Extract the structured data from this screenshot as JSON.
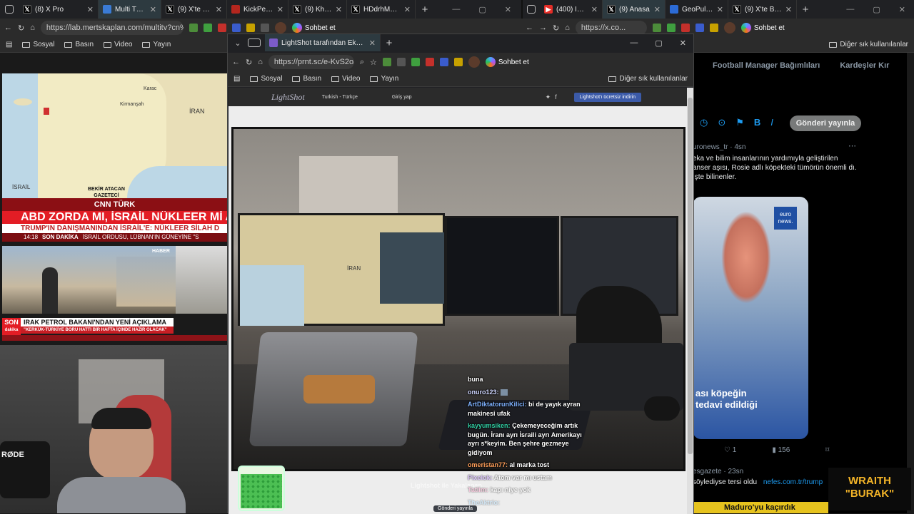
{
  "left_browser": {
    "tabs": [
      {
        "label": "(8) X Pro",
        "icon": "x-logo-icon"
      },
      {
        "label": "Multi TV - Hal",
        "icon": "multitv-icon",
        "active": true
      },
      {
        "label": "(9) X'te Bosna",
        "icon": "x-logo-icon"
      },
      {
        "label": "KickPeek - Kic",
        "icon": "kickpeek-icon"
      },
      {
        "label": "(9) Kharg - Ar",
        "icon": "x-logo-icon"
      },
      {
        "label": "HDdrhM3XIAA",
        "icon": "x-logo-icon"
      }
    ],
    "url": "https://lab.mertskaplan.com/multitv?cn%",
    "chat_button": "Sohbet et",
    "favorites": [
      "Sosyal",
      "Basın",
      "Video",
      "Yayın"
    ]
  },
  "right_browser": {
    "tabs": [
      {
        "label": "(400) Israel Liv",
        "icon": "youtube-icon"
      },
      {
        "label": "(9) Anasa",
        "icon": "x-logo-icon",
        "active": true
      },
      {
        "label": "GeoPulse",
        "icon": "globe-icon"
      },
      {
        "label": "(9) X'te BPT: \"",
        "icon": "x-logo-icon"
      }
    ],
    "url": "https://x.co...",
    "chat_button": "Sohbet et",
    "other_favorites": "Diğer sık kullanılanlar"
  },
  "popup_browser": {
    "tab_title": "LightShot tarafından Ekran Görün",
    "url": "https://prnt.sc/e-KvS2oJt...",
    "chat_button": "Sohbet et",
    "favorites": [
      "Sosyal",
      "Basın",
      "Video",
      "Yayın"
    ],
    "other_favorites": "Diğer sık kullanılanlar",
    "lightshot": {
      "logo": "LightShot",
      "language": "Turkish - Türkçe",
      "login": "Giriş yap",
      "download": "Lightshot'ı ücretsiz indirin"
    }
  },
  "map_panel": {
    "labels": {
      "israil": "İSRAİL",
      "iran": "İRAN",
      "kirmanşah": "Kirmanşah",
      "karac": "Karac"
    },
    "credit_line1": "BEKİR ATACAN",
    "credit_line2": "GAZETECİ"
  },
  "news": {
    "channel": "CNN TÜRK",
    "headline": "ABD ZORDA MI, İSRAİL NÜKLEER Mİ A",
    "subheadline": "TRUMP'IN DANIŞMANINDAN İSRAİL'E: NÜKLEER SİLAH D",
    "time": "14:18",
    "breaking": "SON DAKİKA",
    "ticker": "İSRAİL ORDUSU, LÜBNAN'IN GÜNEYİNE \"S",
    "haber_badge": "HABER",
    "son_dakika_line1": "SON",
    "son_dakika_line2": "dakika",
    "bottom_headline": "IRAK PETROL BAKANI'NDAN YENİ AÇIKLAMA",
    "bottom_sub": "\"KERKÜK-TÜRKİYE BORU HATTI BİR HAFTA İÇİNDE HAZIR OLACAK\""
  },
  "twitter": {
    "nav": [
      "Football Manager Bağımlıları",
      "Kardeşler Kır"
    ],
    "post_button": "Gönderi yayınla",
    "tweet_meta": "uronews_tr · 4sn",
    "tweet_text": "eka ve bilim insanlarının yardımıyla geliştirilen anser aşısı, Rosie adlı köpekteki tümörün önemli dı. İşte bilinenler.",
    "card_logo_line1": "euro",
    "card_logo_line2": "news.",
    "card_caption_line1": "ası köpeğin",
    "card_caption_line2": "tedavi edildiği",
    "likes": "1",
    "views": "156",
    "next_meta": "esgazete · 23sn",
    "next_text": "söylediyse tersi oldu",
    "next_link": "nefes.com.tr/trump",
    "bottom_banner": "Maduro'yu kaçırdık"
  },
  "chat": [
    {
      "user": "",
      "text": "buna",
      "user_color": "#ffffff"
    },
    {
      "user": "onuro123:",
      "text": "",
      "user_color": "#cfd6ff"
    },
    {
      "user": "ArtDiktatorunKilici:",
      "text": "bi de yayık ayran makinesi ufak",
      "user_color": "#7fb2ff"
    },
    {
      "user": "kayyumsiken:",
      "text": "Çekemeyeceğim artık bugün. İranı ayrı İsraili ayrı Amerikayı ayrı s*keyim. Ben şehre gezmeye gidiyom",
      "user_color": "#33d3a8"
    },
    {
      "user": "omeristan77:",
      "text": "al marka tost",
      "user_color": "#ff9f5a"
    },
    {
      "user": "Pixelok:",
      "text": "Atom var mı ustam",
      "user_color": "#c69cff"
    },
    {
      "user": "Tatlim:",
      "text": "kapı niye yok",
      "user_color": "#ff9fc8"
    },
    {
      "user": "TheAktrio:",
      "text": "",
      "user_color": "#8fd0ff"
    }
  ],
  "watermark": {
    "line1": "WRAITH",
    "line2": "\"BURAK\""
  },
  "send_tooltip": "Gönderi yayınla",
  "mic_brand": "RØDE",
  "overlay_text": "Lightshot ile Yakalanan"
}
